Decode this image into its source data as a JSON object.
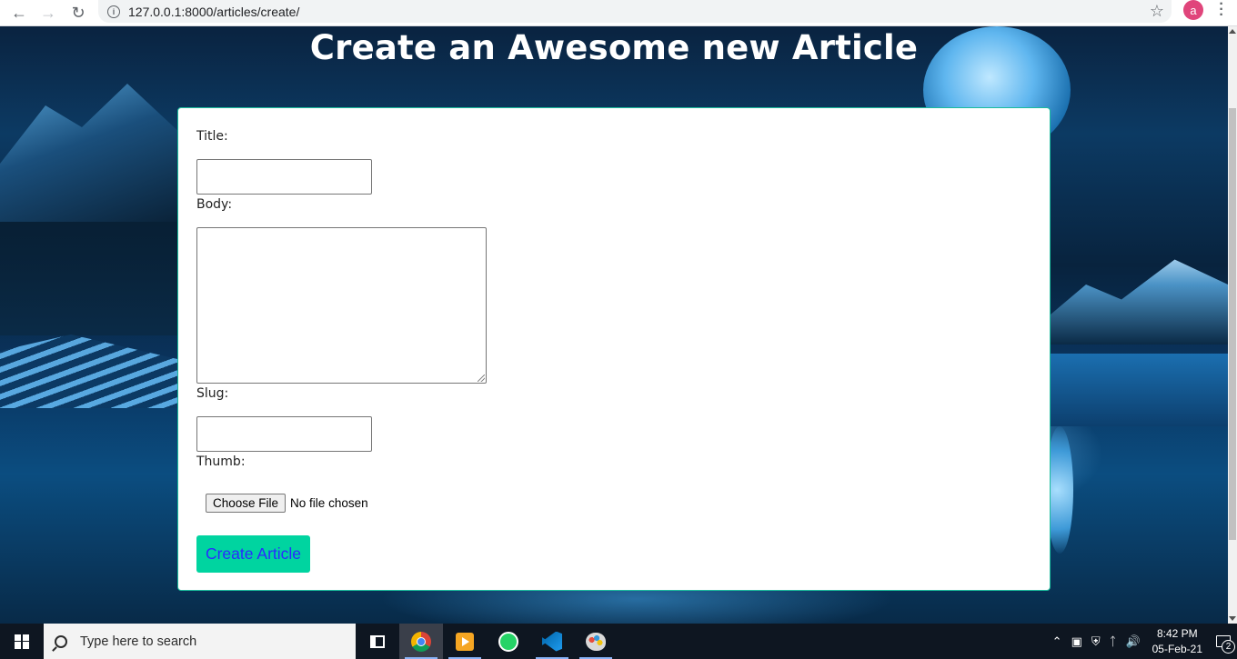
{
  "browser": {
    "url": "127.0.0.1:8000/articles/create/",
    "avatar_letter": "a"
  },
  "page": {
    "heading": "Create an Awesome new Article"
  },
  "form": {
    "title_label": "Title:",
    "title_value": "",
    "body_label": "Body:",
    "body_value": "",
    "slug_label": "Slug:",
    "slug_value": "",
    "thumb_label": "Thumb:",
    "file_button": "Choose File",
    "file_status": "No file chosen",
    "submit_label": "Create Article"
  },
  "taskbar": {
    "search_placeholder": "Type here to search",
    "apps": [
      "task-view",
      "chrome",
      "vlc",
      "whatsapp",
      "vscode",
      "paint"
    ],
    "time": "8:42 PM",
    "date": "05-Feb-21",
    "notification_count": "2"
  },
  "colors": {
    "card_border": "#1abc9c",
    "submit_bg": "#00d4a0",
    "submit_text": "#2a2aff",
    "avatar_bg": "#e0457b"
  }
}
